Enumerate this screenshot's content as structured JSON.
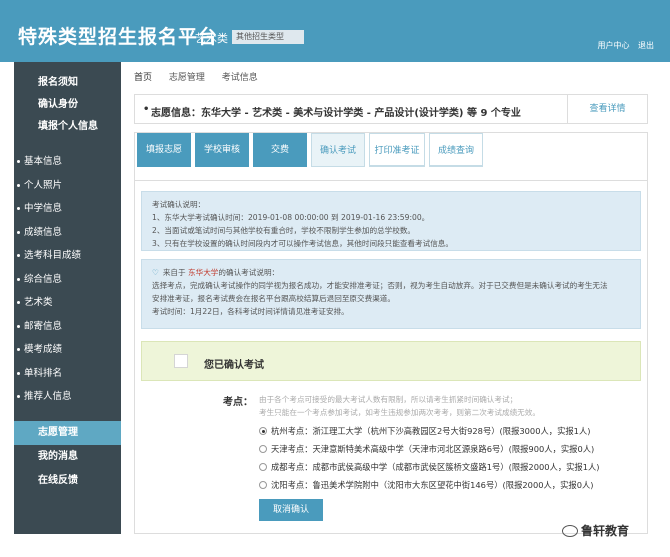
{
  "header": {
    "site_title": "特殊类型招生报名平台",
    "category": "艺术类",
    "type_select": "其他招生类型",
    "user_center": "用户中心",
    "logout": "退出"
  },
  "sidebar": {
    "top_items": [
      "报名须知",
      "确认身份",
      "填报个人信息"
    ],
    "nav_items": [
      "基本信息",
      "个人照片",
      "中学信息",
      "成绩信息",
      "选考科目成绩",
      "综合信息",
      "艺术类",
      "邮寄信息",
      "模考成绩",
      "单科排名",
      "推荐人信息"
    ],
    "bottom_items": [
      "志愿管理",
      "我的消息",
      "在线反馈"
    ],
    "active_item": "志愿管理"
  },
  "breadcrumb": {
    "items": [
      "首页",
      "志愿管理",
      "考试信息"
    ]
  },
  "notice": {
    "text": "志愿信息：东华大学 - 艺术类 - 美术与设计学类 - 产品设计(设计学类) 等 9 个专业",
    "detail_link": "查看详情"
  },
  "tabs": [
    {
      "label": "填报志愿",
      "style": "filled"
    },
    {
      "label": "学校审核",
      "style": "filled"
    },
    {
      "label": "交费",
      "style": "filled"
    },
    {
      "label": "确认考试",
      "style": "current"
    },
    {
      "label": "打印准考证",
      "style": "outline"
    },
    {
      "label": "成绩查询",
      "style": "outline"
    }
  ],
  "instructions": {
    "lines": [
      "考试确认说明：",
      "1、东华大学考试确认时间：2019-01-08 00:00:00 到 2019-01-16 23:59:00。",
      "2、当面试或笔试时间与其他学校有重合时，学校不限制学生参加的总学校数。",
      "3、只有在学校设置的确认时间段内才可以操作考试信息，其他时间段只能查看考试信息。"
    ]
  },
  "school_notice": {
    "prefix": "来自于",
    "school": "东华大学",
    "suffix": "的确认考试说明：",
    "lines": [
      "选择考点，完成确认考试操作的同学视为报名成功，才能安排准考证；否则，视为考生自动放弃。对于已交费但是未确认考试的考生无法",
      "安排准考证，报名考试费会在报名平台跟高校结算后退回至原交费渠道。",
      "考试时间：1月22日，各科考试时间详情请见准考证安排。"
    ]
  },
  "confirmation": {
    "label": "您已确认考试"
  },
  "exam_sites": {
    "label": "考点：",
    "note_lines": [
      "由于各个考点可接受的最大考试人数有限制，所以请考生抓紧时间确认考试；",
      "考生只能在一个考点参加考试，如考生违规参加两次考考，则第二次考试成绩无效。"
    ],
    "options": [
      {
        "text": "杭州考点：浙江理工大学（杭州下沙高教园区2号大街928号）(限报3000人，实报1人)",
        "selected": true
      },
      {
        "text": "天津考点：天津意斯特美术高级中学（天津市河北区源泉路6号）(限报900人，实报0人)",
        "selected": false
      },
      {
        "text": "成都考点：成都市武侯高级中学（成都市武侯区簇桥文盛路1号）(限报2000人，实报1人)",
        "selected": false
      },
      {
        "text": "沈阳考点：鲁迅美术学院附中（沈阳市大东区望花中街146号）(限报2000人，实报0人)",
        "selected": false
      }
    ],
    "cancel_button": "取消确认"
  },
  "watermark": {
    "text": "鲁轩教育"
  }
}
